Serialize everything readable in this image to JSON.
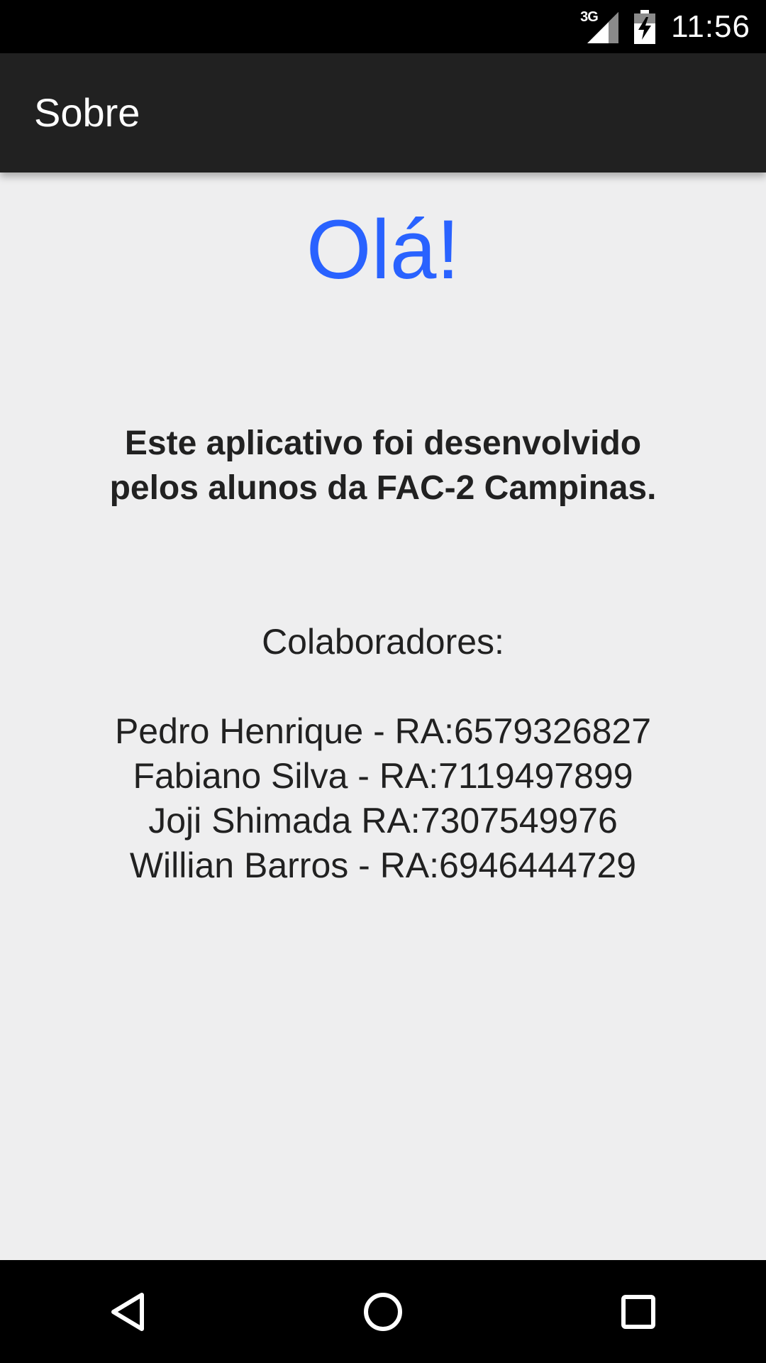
{
  "status_bar": {
    "network_type": "3G",
    "time": "11:56",
    "icons": [
      "signal-icon",
      "battery-charging-icon"
    ]
  },
  "app_bar": {
    "title": "Sobre"
  },
  "main": {
    "greeting": "Olá!",
    "intro_line1": "Este aplicativo foi desenvolvido",
    "intro_line2": "pelos alunos da FAC-2 Campinas.",
    "collaborators_heading": "Colaboradores:",
    "collaborators": [
      "Pedro Henrique - RA:6579326827",
      "Fabiano Silva - RA:7119497899",
      "Joji Shimada RA:7307549976",
      "Willian Barros - RA:6946444729"
    ]
  },
  "nav_bar": {
    "icons": [
      "back-icon",
      "home-icon",
      "recents-icon"
    ]
  },
  "colors": {
    "accent": "#2962ff",
    "app_bar": "#212121",
    "background": "#eeeeef",
    "text": "#212121"
  }
}
